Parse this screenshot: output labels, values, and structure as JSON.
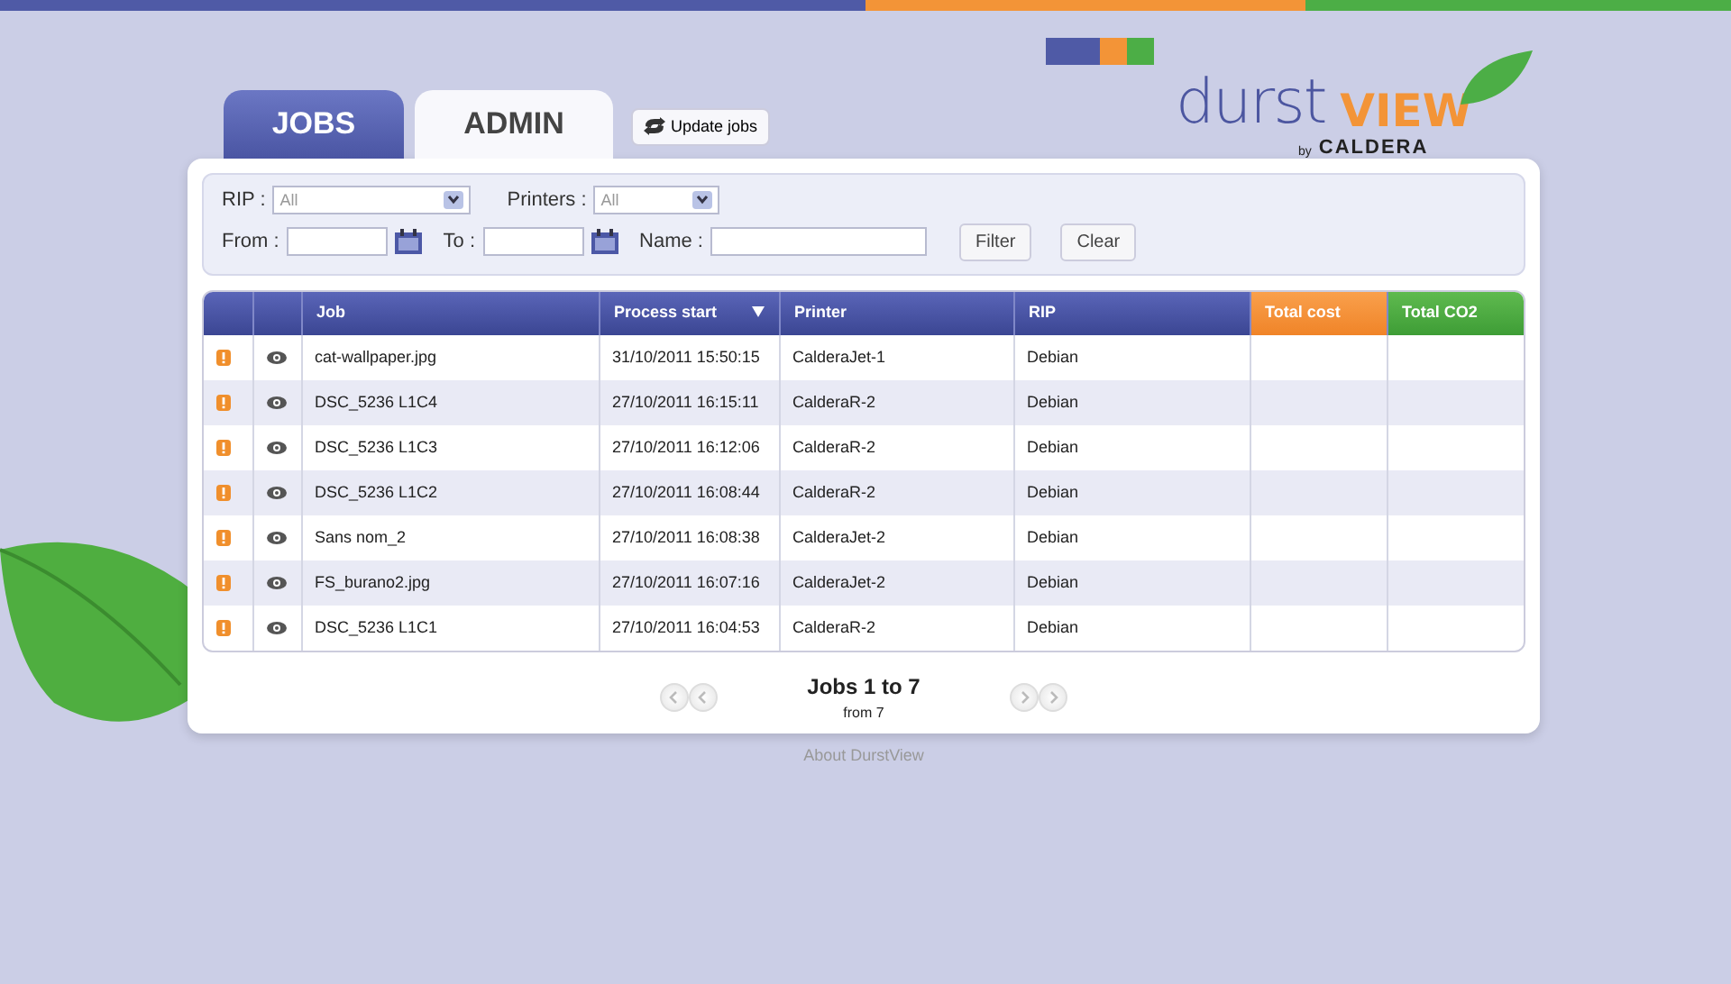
{
  "logo": {
    "brand": "durst",
    "product": "VIEW",
    "by": "by",
    "maker": "CALDERA"
  },
  "tabs": [
    {
      "label": "JOBS",
      "selected": true
    },
    {
      "label": "ADMIN",
      "selected": false
    }
  ],
  "update_button": "Update jobs",
  "filters": {
    "rip": {
      "label": "RIP :",
      "value": "All"
    },
    "printers": {
      "label": "Printers :",
      "value": "All"
    },
    "from": {
      "label": "From :"
    },
    "to": {
      "label": "To :"
    },
    "name": {
      "label": "Name :"
    },
    "buttons": [
      "Filter",
      "Clear"
    ]
  },
  "table": {
    "columns": [
      {
        "kind": "plain",
        "sorted": false
      },
      {
        "kind": "plain",
        "sorted": false
      },
      {
        "label": "Job",
        "kind": "plain",
        "sorted": false
      },
      {
        "label": "Process start",
        "kind": "plain",
        "sorted": true
      },
      {
        "label": "Printer",
        "kind": "plain",
        "sorted": false
      },
      {
        "label": "RIP",
        "kind": "plain",
        "sorted": false
      },
      {
        "label": "Total cost",
        "kind": "cost",
        "sorted": false
      },
      {
        "label": "Total CO2",
        "kind": "co2",
        "sorted": false
      }
    ],
    "rows": [
      {
        "job": "cat-wallpaper.jpg",
        "process_start": "31/10/2011 15:50:15",
        "printer": "CalderaJet-1",
        "rip": "Debian"
      },
      {
        "job": "DSC_5236 L1C4",
        "process_start": "27/10/2011 16:15:11",
        "printer": "CalderaR-2",
        "rip": "Debian"
      },
      {
        "job": "DSC_5236 L1C3",
        "process_start": "27/10/2011 16:12:06",
        "printer": "CalderaR-2",
        "rip": "Debian"
      },
      {
        "job": "DSC_5236 L1C2",
        "process_start": "27/10/2011 16:08:44",
        "printer": "CalderaR-2",
        "rip": "Debian"
      },
      {
        "job": "Sans nom_2",
        "process_start": "27/10/2011 16:08:38",
        "printer": "CalderaJet-2",
        "rip": "Debian"
      },
      {
        "job": "FS_burano2.jpg",
        "process_start": "27/10/2011 16:07:16",
        "printer": "CalderaJet-2",
        "rip": "Debian"
      },
      {
        "job": "DSC_5236 L1C1",
        "process_start": "27/10/2011 16:04:53",
        "printer": "CalderaR-2",
        "rip": "Debian"
      }
    ]
  },
  "pagination": {
    "title": "Jobs 1 to 7",
    "subtitle": "from 7"
  },
  "footer_link": "About DurstView"
}
